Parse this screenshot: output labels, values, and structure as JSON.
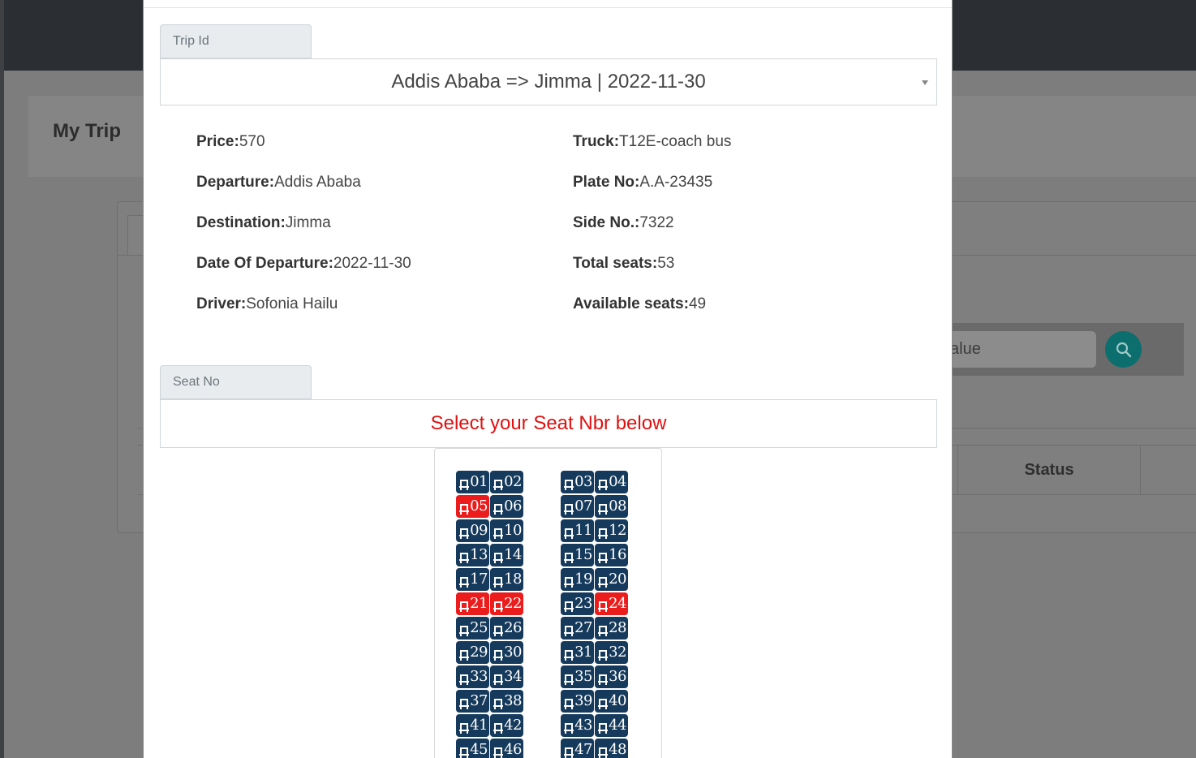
{
  "background": {
    "page_title": "My Trip",
    "search_placeholder": "alue",
    "table_header_status": "Status"
  },
  "modal": {
    "trip_id_label": "Trip Id",
    "trip_select_value": "Addis Ababa => Jimma | 2022-11-30",
    "details_left": [
      {
        "label": "Price:",
        "value": "570"
      },
      {
        "label": "Departure:",
        "value": "Addis Ababa"
      },
      {
        "label": "Destination:",
        "value": "Jimma"
      },
      {
        "label": "Date Of Departure:",
        "value": "2022-11-30"
      },
      {
        "label": "Driver:",
        "value": "Sofonia Hailu"
      }
    ],
    "details_right": [
      {
        "label": "Truck:",
        "value": "T12E-coach bus"
      },
      {
        "label": "Plate No:",
        "value": "A.A-23435"
      },
      {
        "label": "Side No.:",
        "value": "7322"
      },
      {
        "label": "Total seats:",
        "value": "53"
      },
      {
        "label": "Available seats:",
        "value": "49"
      }
    ],
    "seat_no_label": "Seat No",
    "seat_prompt": "Select your Seat Nbr below",
    "seat_colors": {
      "available": "#163a5c",
      "booked": "#ea1c1c"
    },
    "seats": [
      "01",
      "02",
      "03",
      "04",
      "05",
      "06",
      "07",
      "08",
      "09",
      "10",
      "11",
      "12",
      "13",
      "14",
      "15",
      "16",
      "17",
      "18",
      "19",
      "20",
      "21",
      "22",
      "23",
      "24",
      "25",
      "26",
      "27",
      "28",
      "29",
      "30",
      "31",
      "32",
      "33",
      "34",
      "35",
      "36",
      "37",
      "38",
      "39",
      "40",
      "41",
      "42",
      "43",
      "44",
      "45",
      "46",
      "47",
      "48"
    ],
    "booked_seats": [
      "05",
      "21",
      "22",
      "24"
    ]
  }
}
